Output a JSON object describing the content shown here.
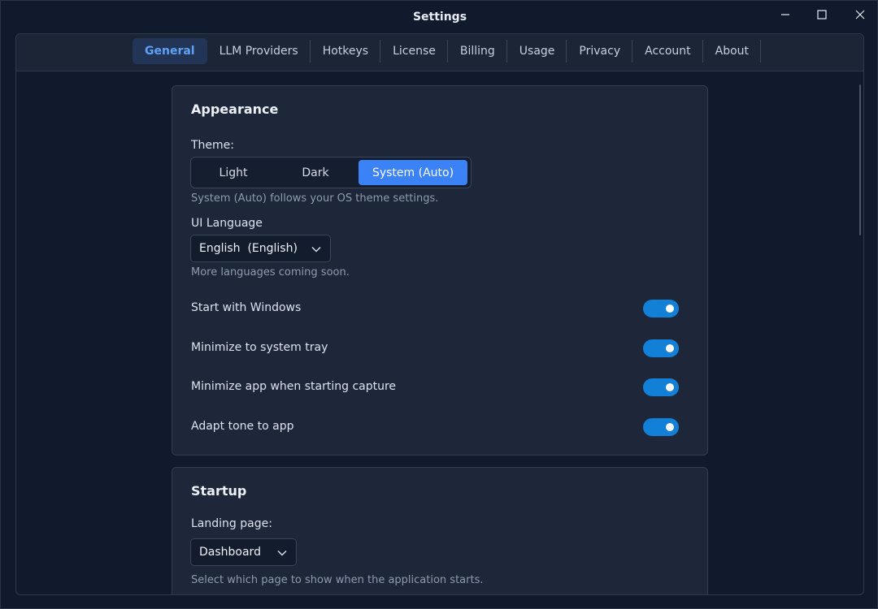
{
  "window": {
    "title": "Settings",
    "controls": [
      "minimize-icon",
      "maximize-icon",
      "close-icon"
    ]
  },
  "tabs": [
    {
      "label": "General",
      "active": true
    },
    {
      "label": "LLM Providers",
      "active": false
    },
    {
      "label": "Hotkeys",
      "active": false
    },
    {
      "label": "License",
      "active": false
    },
    {
      "label": "Billing",
      "active": false
    },
    {
      "label": "Usage",
      "active": false
    },
    {
      "label": "Privacy",
      "active": false
    },
    {
      "label": "Account",
      "active": false
    },
    {
      "label": "About",
      "active": false
    }
  ],
  "appearance": {
    "title": "Appearance",
    "theme_label": "Theme:",
    "theme_options": [
      "Light",
      "Dark",
      "System (Auto)"
    ],
    "theme_selected": "System (Auto)",
    "theme_hint": "System (Auto) follows your OS theme settings.",
    "language_label": "UI Language",
    "language_value": "English  (English)",
    "language_hint": "More languages coming soon.",
    "toggles": [
      {
        "label": "Start with Windows",
        "on": true
      },
      {
        "label": "Minimize to system tray",
        "on": true
      },
      {
        "label": "Minimize app when starting capture",
        "on": true
      },
      {
        "label": "Adapt tone to app",
        "on": true
      }
    ]
  },
  "startup": {
    "title": "Startup",
    "landing_label": "Landing page:",
    "landing_value": "Dashboard",
    "landing_hint": "Select which page to show when the application starts."
  },
  "colors": {
    "accent": "#3b82f6",
    "toggle_on": "#1380d8",
    "active_tab_text": "#5ea2f7"
  }
}
